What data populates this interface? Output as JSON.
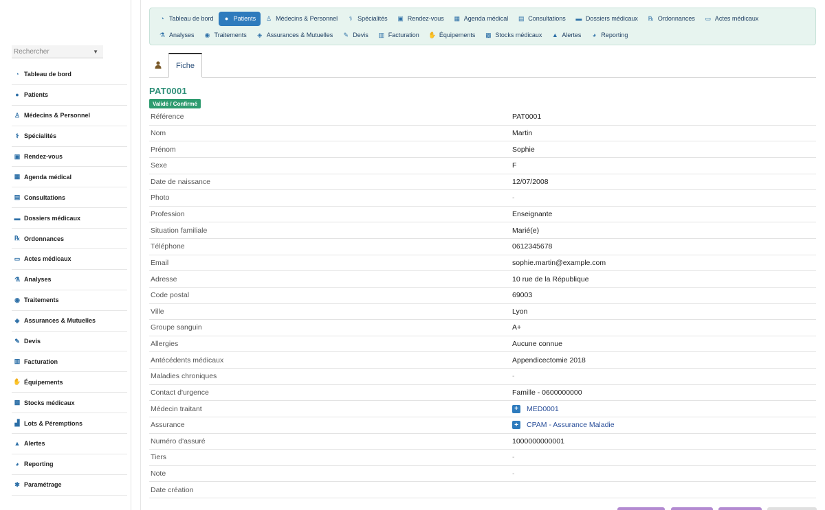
{
  "sidebar": {
    "search_placeholder": "Rechercher",
    "items": [
      {
        "label": "Tableau de bord",
        "icon": "dashboard-icon",
        "glyph": "◔"
      },
      {
        "label": "Patients",
        "icon": "user-icon",
        "glyph": "●"
      },
      {
        "label": "Médecins & Personnel",
        "icon": "doctor-icon",
        "glyph": "♙"
      },
      {
        "label": "Spécialités",
        "icon": "stethoscope-icon",
        "glyph": "⚕"
      },
      {
        "label": "Rendez-vous",
        "icon": "calendar-check-icon",
        "glyph": "▣"
      },
      {
        "label": "Agenda médical",
        "icon": "calendar-icon",
        "glyph": "▦"
      },
      {
        "label": "Consultations",
        "icon": "clipboard-icon",
        "glyph": "▤"
      },
      {
        "label": "Dossiers médicaux",
        "icon": "folder-icon",
        "glyph": "▬"
      },
      {
        "label": "Ordonnances",
        "icon": "prescription-icon",
        "glyph": "℞"
      },
      {
        "label": "Actes médicaux",
        "icon": "bed-icon",
        "glyph": "▭"
      },
      {
        "label": "Analyses",
        "icon": "flask-icon",
        "glyph": "⚗"
      },
      {
        "label": "Traitements",
        "icon": "pills-icon",
        "glyph": "◉"
      },
      {
        "label": "Assurances & Mutuelles",
        "icon": "shield-icon",
        "glyph": "◈"
      },
      {
        "label": "Devis",
        "icon": "edit-icon",
        "glyph": "✎"
      },
      {
        "label": "Facturation",
        "icon": "invoice-icon",
        "glyph": "▥"
      },
      {
        "label": "Équipements",
        "icon": "hand-holding-icon",
        "glyph": "✋"
      },
      {
        "label": "Stocks médicaux",
        "icon": "boxes-icon",
        "glyph": "▩"
      },
      {
        "label": "Lots & Péremptions",
        "icon": "pallet-icon",
        "glyph": "▟"
      },
      {
        "label": "Alertes",
        "icon": "warning-icon",
        "glyph": "▲"
      },
      {
        "label": "Reporting",
        "icon": "chart-pie-icon",
        "glyph": "◕"
      },
      {
        "label": "Paramétrage",
        "icon": "gear-icon",
        "glyph": "✱"
      }
    ]
  },
  "topnav": {
    "row1": [
      {
        "label": "Tableau de bord",
        "icon": "dashboard-icon",
        "glyph": "◔",
        "active": false
      },
      {
        "label": "Patients",
        "icon": "user-icon",
        "glyph": "●",
        "active": true
      },
      {
        "label": "Médecins & Personnel",
        "icon": "doctor-icon",
        "glyph": "♙",
        "active": false
      },
      {
        "label": "Spécialités",
        "icon": "stethoscope-icon",
        "glyph": "⚕",
        "active": false
      },
      {
        "label": "Rendez-vous",
        "icon": "calendar-check-icon",
        "glyph": "▣",
        "active": false
      },
      {
        "label": "Agenda médical",
        "icon": "calendar-icon",
        "glyph": "▦",
        "active": false
      },
      {
        "label": "Consultations",
        "icon": "clipboard-icon",
        "glyph": "▤",
        "active": false
      },
      {
        "label": "Dossiers médicaux",
        "icon": "folder-icon",
        "glyph": "▬",
        "active": false
      },
      {
        "label": "Ordonnances",
        "icon": "prescription-icon",
        "glyph": "℞",
        "active": false
      },
      {
        "label": "Actes médicaux",
        "icon": "bed-icon",
        "glyph": "▭",
        "active": false
      }
    ],
    "row2": [
      {
        "label": "Analyses",
        "icon": "flask-icon",
        "glyph": "⚗"
      },
      {
        "label": "Traitements",
        "icon": "pills-icon",
        "glyph": "◉"
      },
      {
        "label": "Assurances & Mutuelles",
        "icon": "shield-icon",
        "glyph": "◈"
      },
      {
        "label": "Devis",
        "icon": "edit-icon",
        "glyph": "✎"
      },
      {
        "label": "Facturation",
        "icon": "invoice-icon",
        "glyph": "▥"
      },
      {
        "label": "Équipements",
        "icon": "hand-holding-icon",
        "glyph": "✋"
      },
      {
        "label": "Stocks médicaux",
        "icon": "boxes-icon",
        "glyph": "▩"
      },
      {
        "label": "Alertes",
        "icon": "warning-icon",
        "glyph": "▲"
      },
      {
        "label": "Reporting",
        "icon": "chart-pie-icon",
        "glyph": "◕"
      }
    ]
  },
  "tabs": {
    "fiche_label": "Fiche"
  },
  "record": {
    "ref": "PAT0001",
    "status_badge": "Validé / Confirmé",
    "fields": [
      {
        "label": "Référence",
        "value": "PAT0001",
        "type": "text"
      },
      {
        "label": "Nom",
        "value": "Martin",
        "type": "text"
      },
      {
        "label": "Prénom",
        "value": "Sophie",
        "type": "text"
      },
      {
        "label": "Sexe",
        "value": "F",
        "type": "text"
      },
      {
        "label": "Date de naissance",
        "value": "12/07/2008",
        "type": "text"
      },
      {
        "label": "Photo",
        "value": "-",
        "type": "empty"
      },
      {
        "label": "Profession",
        "value": "Enseignante",
        "type": "text"
      },
      {
        "label": "Situation familiale",
        "value": "Marié(e)",
        "type": "text"
      },
      {
        "label": "Téléphone",
        "value": "0612345678",
        "type": "text"
      },
      {
        "label": "Email",
        "value": "sophie.martin@example.com",
        "type": "text"
      },
      {
        "label": "Adresse",
        "value": "10 rue de la République",
        "type": "text"
      },
      {
        "label": "Code postal",
        "value": "69003",
        "type": "text"
      },
      {
        "label": "Ville",
        "value": "Lyon",
        "type": "text"
      },
      {
        "label": "Groupe sanguin",
        "value": "A+",
        "type": "text"
      },
      {
        "label": "Allergies",
        "value": "Aucune connue",
        "type": "text"
      },
      {
        "label": "Antécédents médicaux",
        "value": "Appendicectomie 2018",
        "type": "text"
      },
      {
        "label": "Maladies chroniques",
        "value": "-",
        "type": "empty"
      },
      {
        "label": "Contact d'urgence",
        "value": "Famille - 0600000000",
        "type": "text"
      },
      {
        "label": "Médecin traitant",
        "value": "MED0001",
        "type": "link"
      },
      {
        "label": "Assurance",
        "value": "CPAM - Assurance Maladie",
        "type": "link"
      },
      {
        "label": "Numéro d'assuré",
        "value": "1000000000001",
        "type": "text"
      },
      {
        "label": "Tiers",
        "value": "-",
        "type": "empty"
      },
      {
        "label": "Note",
        "value": "-",
        "type": "empty"
      },
      {
        "label": "Date création",
        "value": "",
        "type": "text"
      }
    ]
  },
  "colors": {
    "accent": "#2e7bbd",
    "nav_bg": "#e7f4ef",
    "title_green": "#2f8f78",
    "badge_green": "#2e9b6f",
    "button_purple": "#b38ad1"
  }
}
